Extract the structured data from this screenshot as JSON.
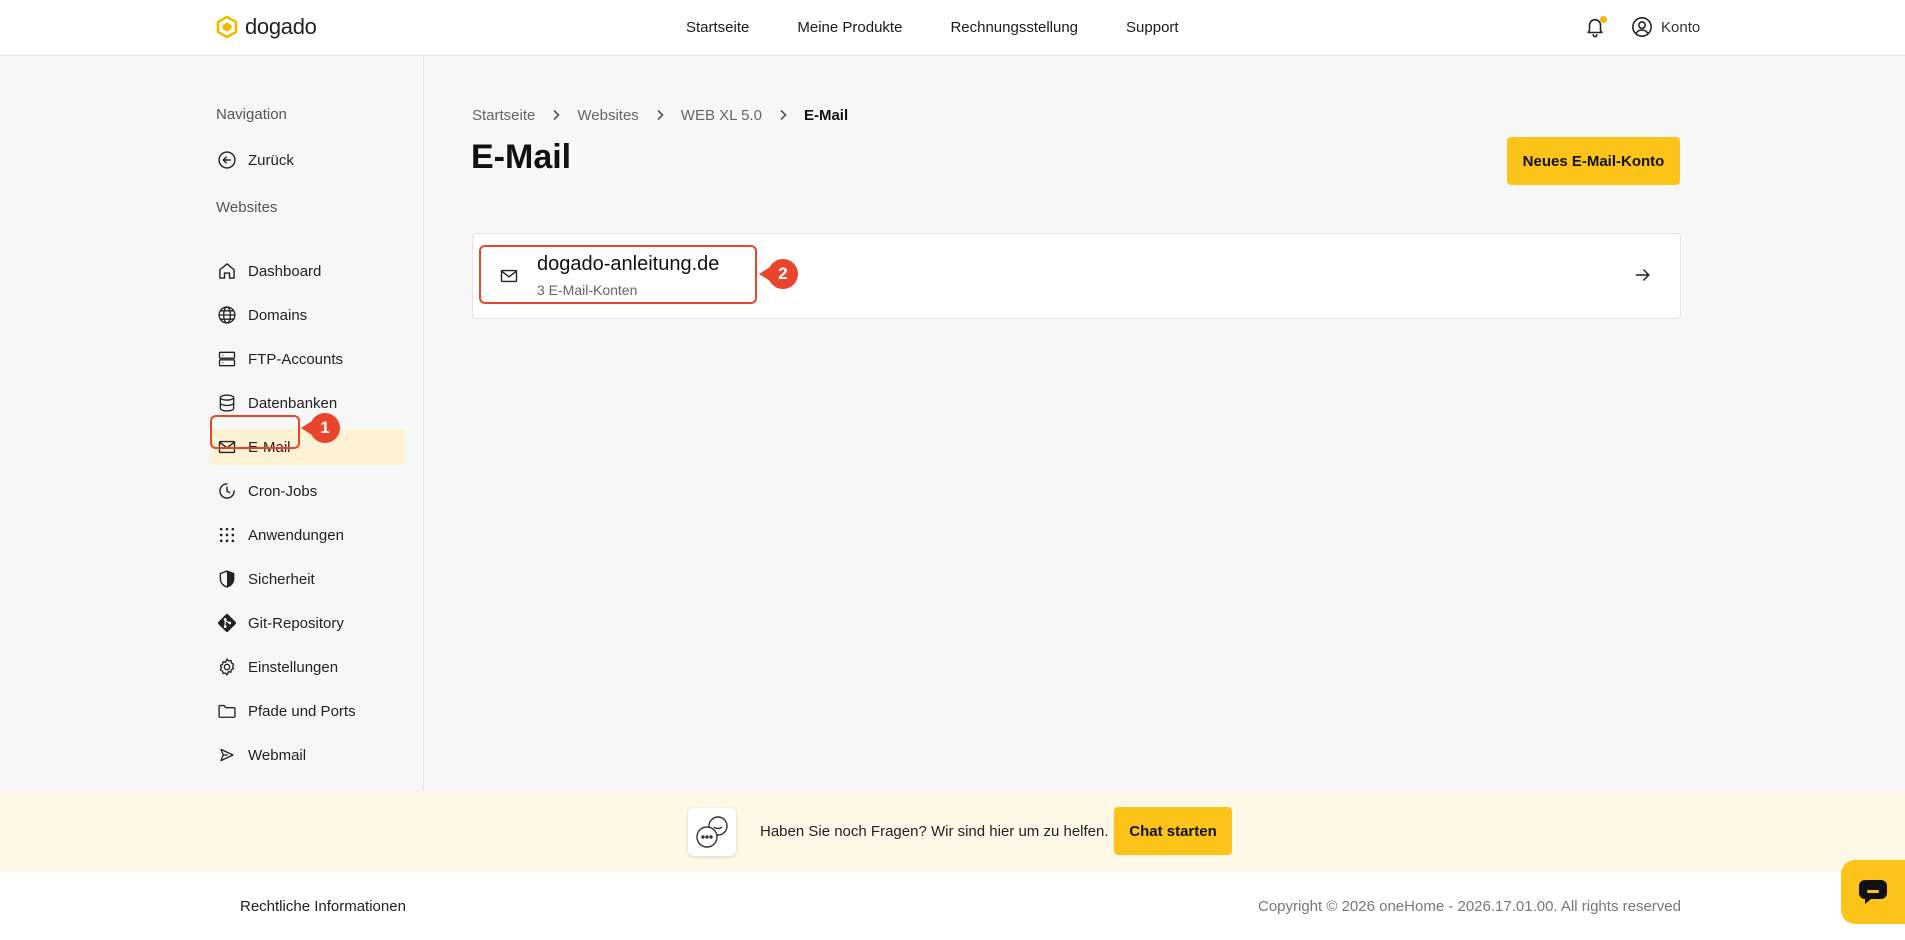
{
  "header": {
    "logo_text": "dogado",
    "nav": [
      "Startseite",
      "Meine Produkte",
      "Rechnungsstellung",
      "Support"
    ],
    "account_label": "Konto"
  },
  "sidebar": {
    "navigation_heading": "Navigation",
    "back_label": "Zurück",
    "websites_heading": "Websites",
    "items": [
      {
        "label": "Dashboard",
        "icon": "home-icon"
      },
      {
        "label": "Domains",
        "icon": "globe-icon"
      },
      {
        "label": "FTP-Accounts",
        "icon": "server-icon"
      },
      {
        "label": "Datenbanken",
        "icon": "database-icon"
      },
      {
        "label": "E-Mail",
        "icon": "mail-icon",
        "active": true
      },
      {
        "label": "Cron-Jobs",
        "icon": "clock-icon"
      },
      {
        "label": "Anwendungen",
        "icon": "grid-icon"
      },
      {
        "label": "Sicherheit",
        "icon": "shield-icon"
      },
      {
        "label": "Git-Repository",
        "icon": "git-icon"
      },
      {
        "label": "Einstellungen",
        "icon": "gear-icon"
      },
      {
        "label": "Pfade und Ports",
        "icon": "folder-icon"
      },
      {
        "label": "Webmail",
        "icon": "send-icon"
      }
    ]
  },
  "breadcrumb": [
    "Startseite",
    "Websites",
    "WEB XL 5.0",
    "E-Mail"
  ],
  "page_title": "E-Mail",
  "new_account_button": "Neues E-Mail-Konto",
  "domain_card": {
    "name": "dogado-anleitung.de",
    "subtitle": "3 E-Mail-Konten"
  },
  "annotations": [
    "1",
    "2"
  ],
  "help": {
    "text": "Haben Sie noch Fragen? Wir sind hier um zu helfen.",
    "button": "Chat starten"
  },
  "footer": {
    "legal": "Rechtliche Informationen",
    "copyright": "Copyright © 2026 oneHome - 2026.17.01.00. All rights reserved"
  },
  "colors": {
    "accent": "#fcc419",
    "highlight": "#e8452c",
    "active_bg": "#fdf3d4"
  }
}
